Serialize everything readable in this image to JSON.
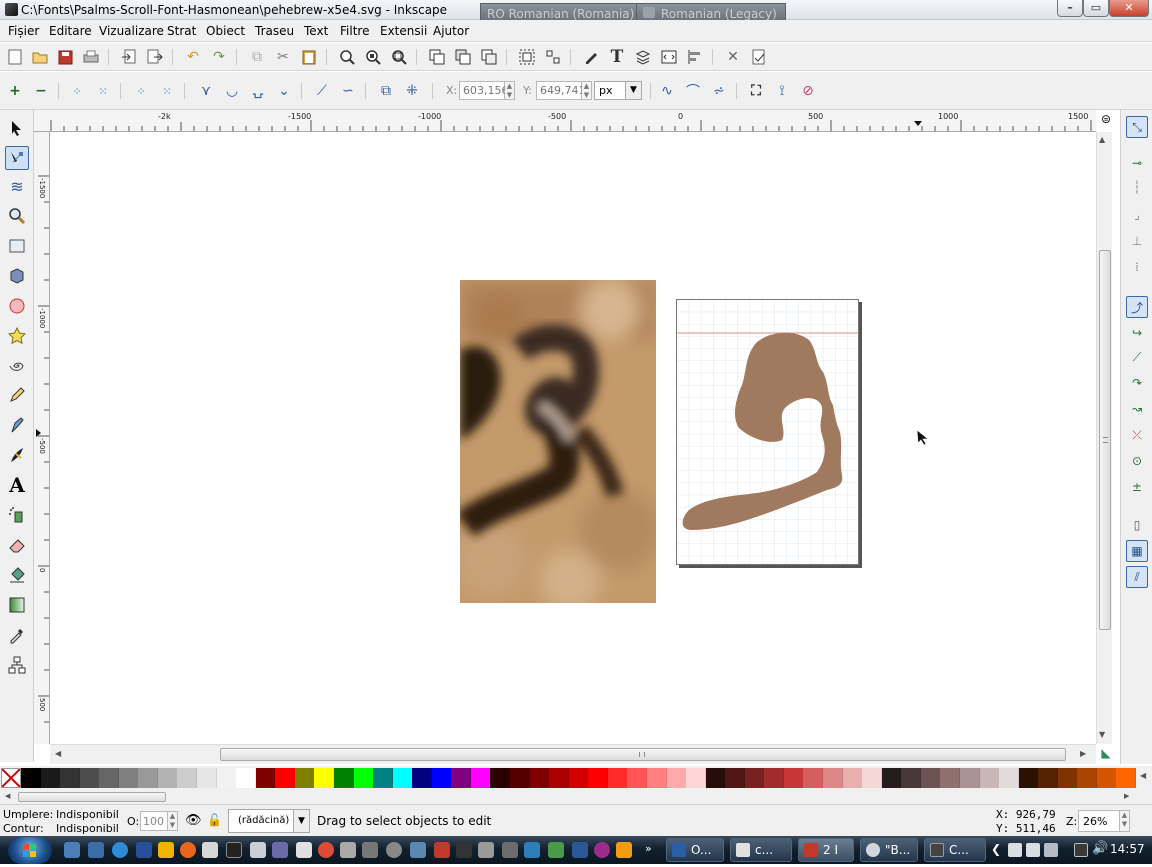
{
  "window": {
    "title": "C:\\Fonts\\Psalms-Scroll-Font-Hasmonean\\pehebrew-x5e4.svg - Inkscape",
    "lang_tab_1": "RO Romanian (Romania)",
    "lang_tab_2": "Romanian (Legacy)",
    "btn_minimize": "–",
    "btn_maximize": "▭",
    "btn_close": "✕"
  },
  "menu": {
    "items": [
      "Fișier",
      "Editare",
      "Vizualizare",
      "Strat",
      "Obiect",
      "Traseu",
      "Text",
      "Filtre",
      "Extensii",
      "Ajutor"
    ]
  },
  "node_toolbar": {
    "x_label": "X:",
    "x_value": "603,156",
    "y_label": "Y:",
    "y_value": "649,741",
    "unit": "px"
  },
  "rulers": {
    "horizontal_labels": [
      "-2k",
      "-1500",
      "-1000",
      "-500",
      "0",
      "500",
      "1000",
      "1500"
    ],
    "vertical_labels": [
      "-1500",
      "-1000",
      "-500",
      "0",
      "500"
    ]
  },
  "canvas": {
    "glyph_color": "#a07a5e",
    "guide_color": "#e08a8a",
    "grid_color": "#d6e2ec"
  },
  "palette": {
    "colors": [
      "#000000",
      "#1a1a1a",
      "#333333",
      "#4d4d4d",
      "#666666",
      "#808080",
      "#999999",
      "#b3b3b3",
      "#cccccc",
      "#e6e6e6",
      "#f2f2f2",
      "#ffffff",
      "#800000",
      "#ff0000",
      "#808000",
      "#ffff00",
      "#008000",
      "#00ff00",
      "#008080",
      "#00ffff",
      "#000080",
      "#0000ff",
      "#800080",
      "#ff00ff",
      "#2b0000",
      "#550000",
      "#800000",
      "#aa0000",
      "#d40000",
      "#ff0000",
      "#ff2a2a",
      "#ff5555",
      "#ff8080",
      "#ffaaaa",
      "#ffd5d5",
      "#280b0b",
      "#501616",
      "#782121",
      "#a02c2c",
      "#c83737",
      "#d35f5f",
      "#de8787",
      "#e9afaf",
      "#f4d7d7",
      "#241c1c",
      "#483737",
      "#6c5353",
      "#916f6f",
      "#ac9393",
      "#c8b7b7",
      "#e3dbdb",
      "#2b1100",
      "#552200",
      "#803300",
      "#aa4400",
      "#d45500",
      "#ff6600"
    ]
  },
  "status": {
    "fill_label": "Umplere:",
    "fill_value": "Indisponibil",
    "stroke_label": "Contur:",
    "stroke_value": "Indisponibil",
    "opacity_label": "O:",
    "opacity_value": "100",
    "layer_value": "(rădăcină)",
    "message": "Drag to select objects to edit",
    "x_readout": "X:  926,79",
    "y_readout": "Y:  511,46",
    "zoom_label": "Z:",
    "zoom_value": "26%"
  },
  "taskbar": {
    "tasks": [
      "O...",
      "c...",
      "2 I",
      "\"B...",
      "C..."
    ],
    "clock": "14:57"
  }
}
